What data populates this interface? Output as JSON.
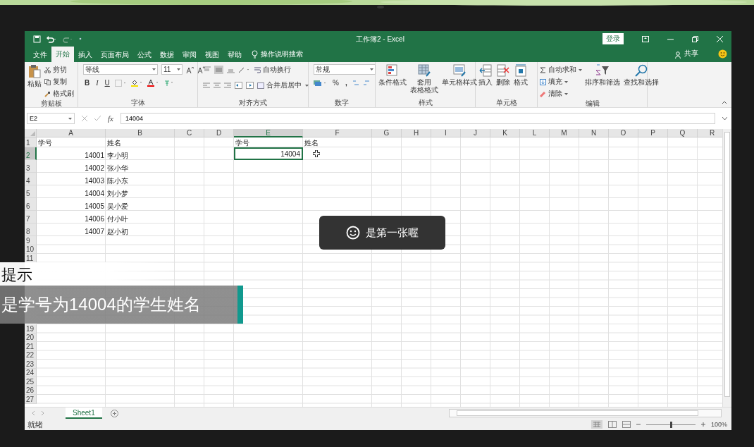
{
  "window": {
    "title": "工作簿2 - Excel",
    "sign_in": "登录"
  },
  "tabs": [
    {
      "label": "文件",
      "selected": false
    },
    {
      "label": "开始",
      "selected": true
    },
    {
      "label": "插入",
      "selected": false
    },
    {
      "label": "页面布局",
      "selected": false
    },
    {
      "label": "公式",
      "selected": false
    },
    {
      "label": "数据",
      "selected": false
    },
    {
      "label": "审阅",
      "selected": false
    },
    {
      "label": "视图",
      "selected": false
    },
    {
      "label": "帮助",
      "selected": false
    }
  ],
  "tell_me": "操作说明搜索",
  "share": "共享",
  "ribbon": {
    "clipboard": {
      "label": "剪贴板",
      "paste": "粘贴",
      "cut": "剪切",
      "copy": "复制",
      "format_painter": "格式刷"
    },
    "font": {
      "label": "字体",
      "font_name": "等线",
      "font_size": "11",
      "bold": "B",
      "italic": "I",
      "underline": "U"
    },
    "alignment": {
      "label": "对齐方式",
      "wrap_text": "自动换行",
      "merge_center": "合并后居中"
    },
    "number": {
      "label": "数字",
      "format": "常规",
      "percent": "%",
      "comma": ","
    },
    "styles": {
      "label": "样式",
      "conditional": "条件格式",
      "format_table": [
        "套用",
        "表格格式"
      ],
      "cell_styles": "单元格样式"
    },
    "cells": {
      "label": "单元格",
      "insert": "插入",
      "delete": "删除",
      "format": "格式"
    },
    "editing": {
      "label": "编辑",
      "autosum": "自动求和",
      "fill": "填充",
      "clear": "清除",
      "sort_filter": "排序和筛选",
      "find_select": "查找和选择"
    }
  },
  "formula_bar": {
    "name_box": "E2",
    "function_label": "fx",
    "value": "14004"
  },
  "columns": [
    {
      "label": "A",
      "selected": false
    },
    {
      "label": "B",
      "selected": false
    },
    {
      "label": "C",
      "selected": false
    },
    {
      "label": "D",
      "selected": false
    },
    {
      "label": "E",
      "selected": true
    },
    {
      "label": "F",
      "selected": false
    },
    {
      "label": "G",
      "selected": false
    },
    {
      "label": "H",
      "selected": false
    },
    {
      "label": "I",
      "selected": false
    },
    {
      "label": "J",
      "selected": false
    },
    {
      "label": "K",
      "selected": false
    },
    {
      "label": "L",
      "selected": false
    },
    {
      "label": "M",
      "selected": false
    },
    {
      "label": "N",
      "selected": false
    },
    {
      "label": "O",
      "selected": false
    },
    {
      "label": "P",
      "selected": false
    },
    {
      "label": "Q",
      "selected": false
    },
    {
      "label": "R",
      "selected": false
    }
  ],
  "rows": [
    {
      "header": "1",
      "selected": false,
      "cells": {
        "A": {
          "text": "学号",
          "kind": "text"
        },
        "B": {
          "text": "姓名",
          "kind": "text"
        },
        "E": {
          "text": "学号",
          "kind": "text"
        },
        "F": {
          "text": "姓名",
          "kind": "text"
        }
      }
    },
    {
      "header": "2",
      "selected": true,
      "cells": {
        "A": {
          "text": "14001",
          "kind": "number"
        },
        "B": {
          "text": "李小明",
          "kind": "text"
        },
        "E": {
          "text": "14004",
          "kind": "number"
        }
      }
    },
    {
      "header": "3",
      "selected": false,
      "cells": {
        "A": {
          "text": "14002",
          "kind": "number"
        },
        "B": {
          "text": "张小华",
          "kind": "text"
        }
      }
    },
    {
      "header": "4",
      "selected": false,
      "cells": {
        "A": {
          "text": "14003",
          "kind": "number"
        },
        "B": {
          "text": "陈小东",
          "kind": "text"
        }
      }
    },
    {
      "header": "5",
      "selected": false,
      "cells": {
        "A": {
          "text": "14004",
          "kind": "number"
        },
        "B": {
          "text": "刘小梦",
          "kind": "text"
        }
      }
    },
    {
      "header": "6",
      "selected": false,
      "cells": {
        "A": {
          "text": "14005",
          "kind": "number"
        },
        "B": {
          "text": "吴小爱",
          "kind": "text"
        }
      }
    },
    {
      "header": "7",
      "selected": false,
      "cells": {
        "A": {
          "text": "14006",
          "kind": "number"
        },
        "B": {
          "text": "付小叶",
          "kind": "text"
        }
      }
    },
    {
      "header": "8",
      "selected": false,
      "cells": {
        "A": {
          "text": "14007",
          "kind": "number"
        },
        "B": {
          "text": "赵小初",
          "kind": "text"
        }
      }
    },
    {
      "header": "9",
      "selected": false
    },
    {
      "header": "10",
      "selected": false
    },
    {
      "header": "11",
      "selected": false
    },
    {},
    {},
    {},
    {},
    {},
    {},
    {},
    {
      "header": "19",
      "selected": false
    },
    {
      "header": "20",
      "selected": false
    },
    {
      "header": "21",
      "selected": false
    },
    {
      "header": "22",
      "selected": false
    },
    {
      "header": "23",
      "selected": false
    },
    {
      "header": "24",
      "selected": false
    },
    {
      "header": "25",
      "selected": false
    },
    {
      "header": "26",
      "selected": false
    },
    {
      "header": "27",
      "selected": false
    }
  ],
  "sheet_tabs": [
    {
      "label": "Sheet1",
      "selected": true
    }
  ],
  "status_bar": {
    "status": "就绪",
    "zoom": "100%",
    "zoom_slider": {
      "level": 0.5
    }
  },
  "toast": {
    "text": "是第一张喔"
  },
  "hint": {
    "title": "提示",
    "text": "是学号为14004的学生姓名"
  }
}
